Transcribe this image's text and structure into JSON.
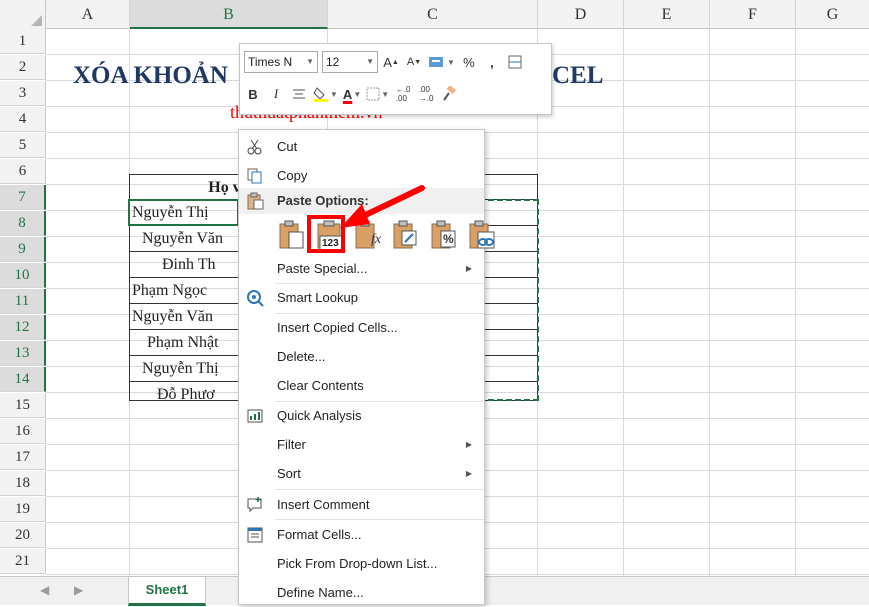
{
  "spreadsheet": {
    "columns": [
      "A",
      "B",
      "C",
      "D",
      "E",
      "F",
      "G"
    ],
    "rows": [
      "1",
      "2",
      "3",
      "4",
      "5",
      "6",
      "7",
      "8",
      "9",
      "10",
      "11",
      "12",
      "13",
      "14",
      "15",
      "16",
      "17",
      "18",
      "19",
      "20",
      "21"
    ],
    "title_left": "XÓA KHOẢN",
    "title_right": "CEL",
    "subtitle": "thuthuatphanmem.vn",
    "table_header": "Họ và",
    "names": [
      "Nguyễn    Thị",
      "Nguyễn Văn",
      "Đinh      Th",
      "Phạm Ngọc",
      "Nguyễn Văn",
      "Phạm  Nhật",
      "Nguyễn Thị",
      "Đỗ      Phươ"
    ]
  },
  "sheet_tabs": {
    "active": "Sheet1"
  },
  "mini_toolbar": {
    "font_name": "Times N",
    "font_size": "12",
    "bold": "B",
    "italic": "I",
    "percent": "%",
    "comma": ","
  },
  "context_menu": {
    "cut": "Cut",
    "copy": "Copy",
    "paste_options": "Paste Options:",
    "paste_special": "Paste Special...",
    "smart_lookup": "Smart Lookup",
    "insert_copied_cells": "Insert Copied Cells...",
    "delete": "Delete...",
    "clear_contents": "Clear Contents",
    "quick_analysis": "Quick Analysis",
    "filter": "Filter",
    "sort": "Sort",
    "insert_comment": "Insert Comment",
    "format_cells": "Format Cells...",
    "pick_from_dropdown": "Pick From Drop-down List...",
    "define_name": "Define Name...",
    "paste_values_badge": "123",
    "paste_formula_badge": "fx",
    "paste_format_badge": "%"
  },
  "colors": {
    "excel_green": "#217346",
    "title_blue": "#1f3864",
    "highlight_red": "#ff0000"
  }
}
